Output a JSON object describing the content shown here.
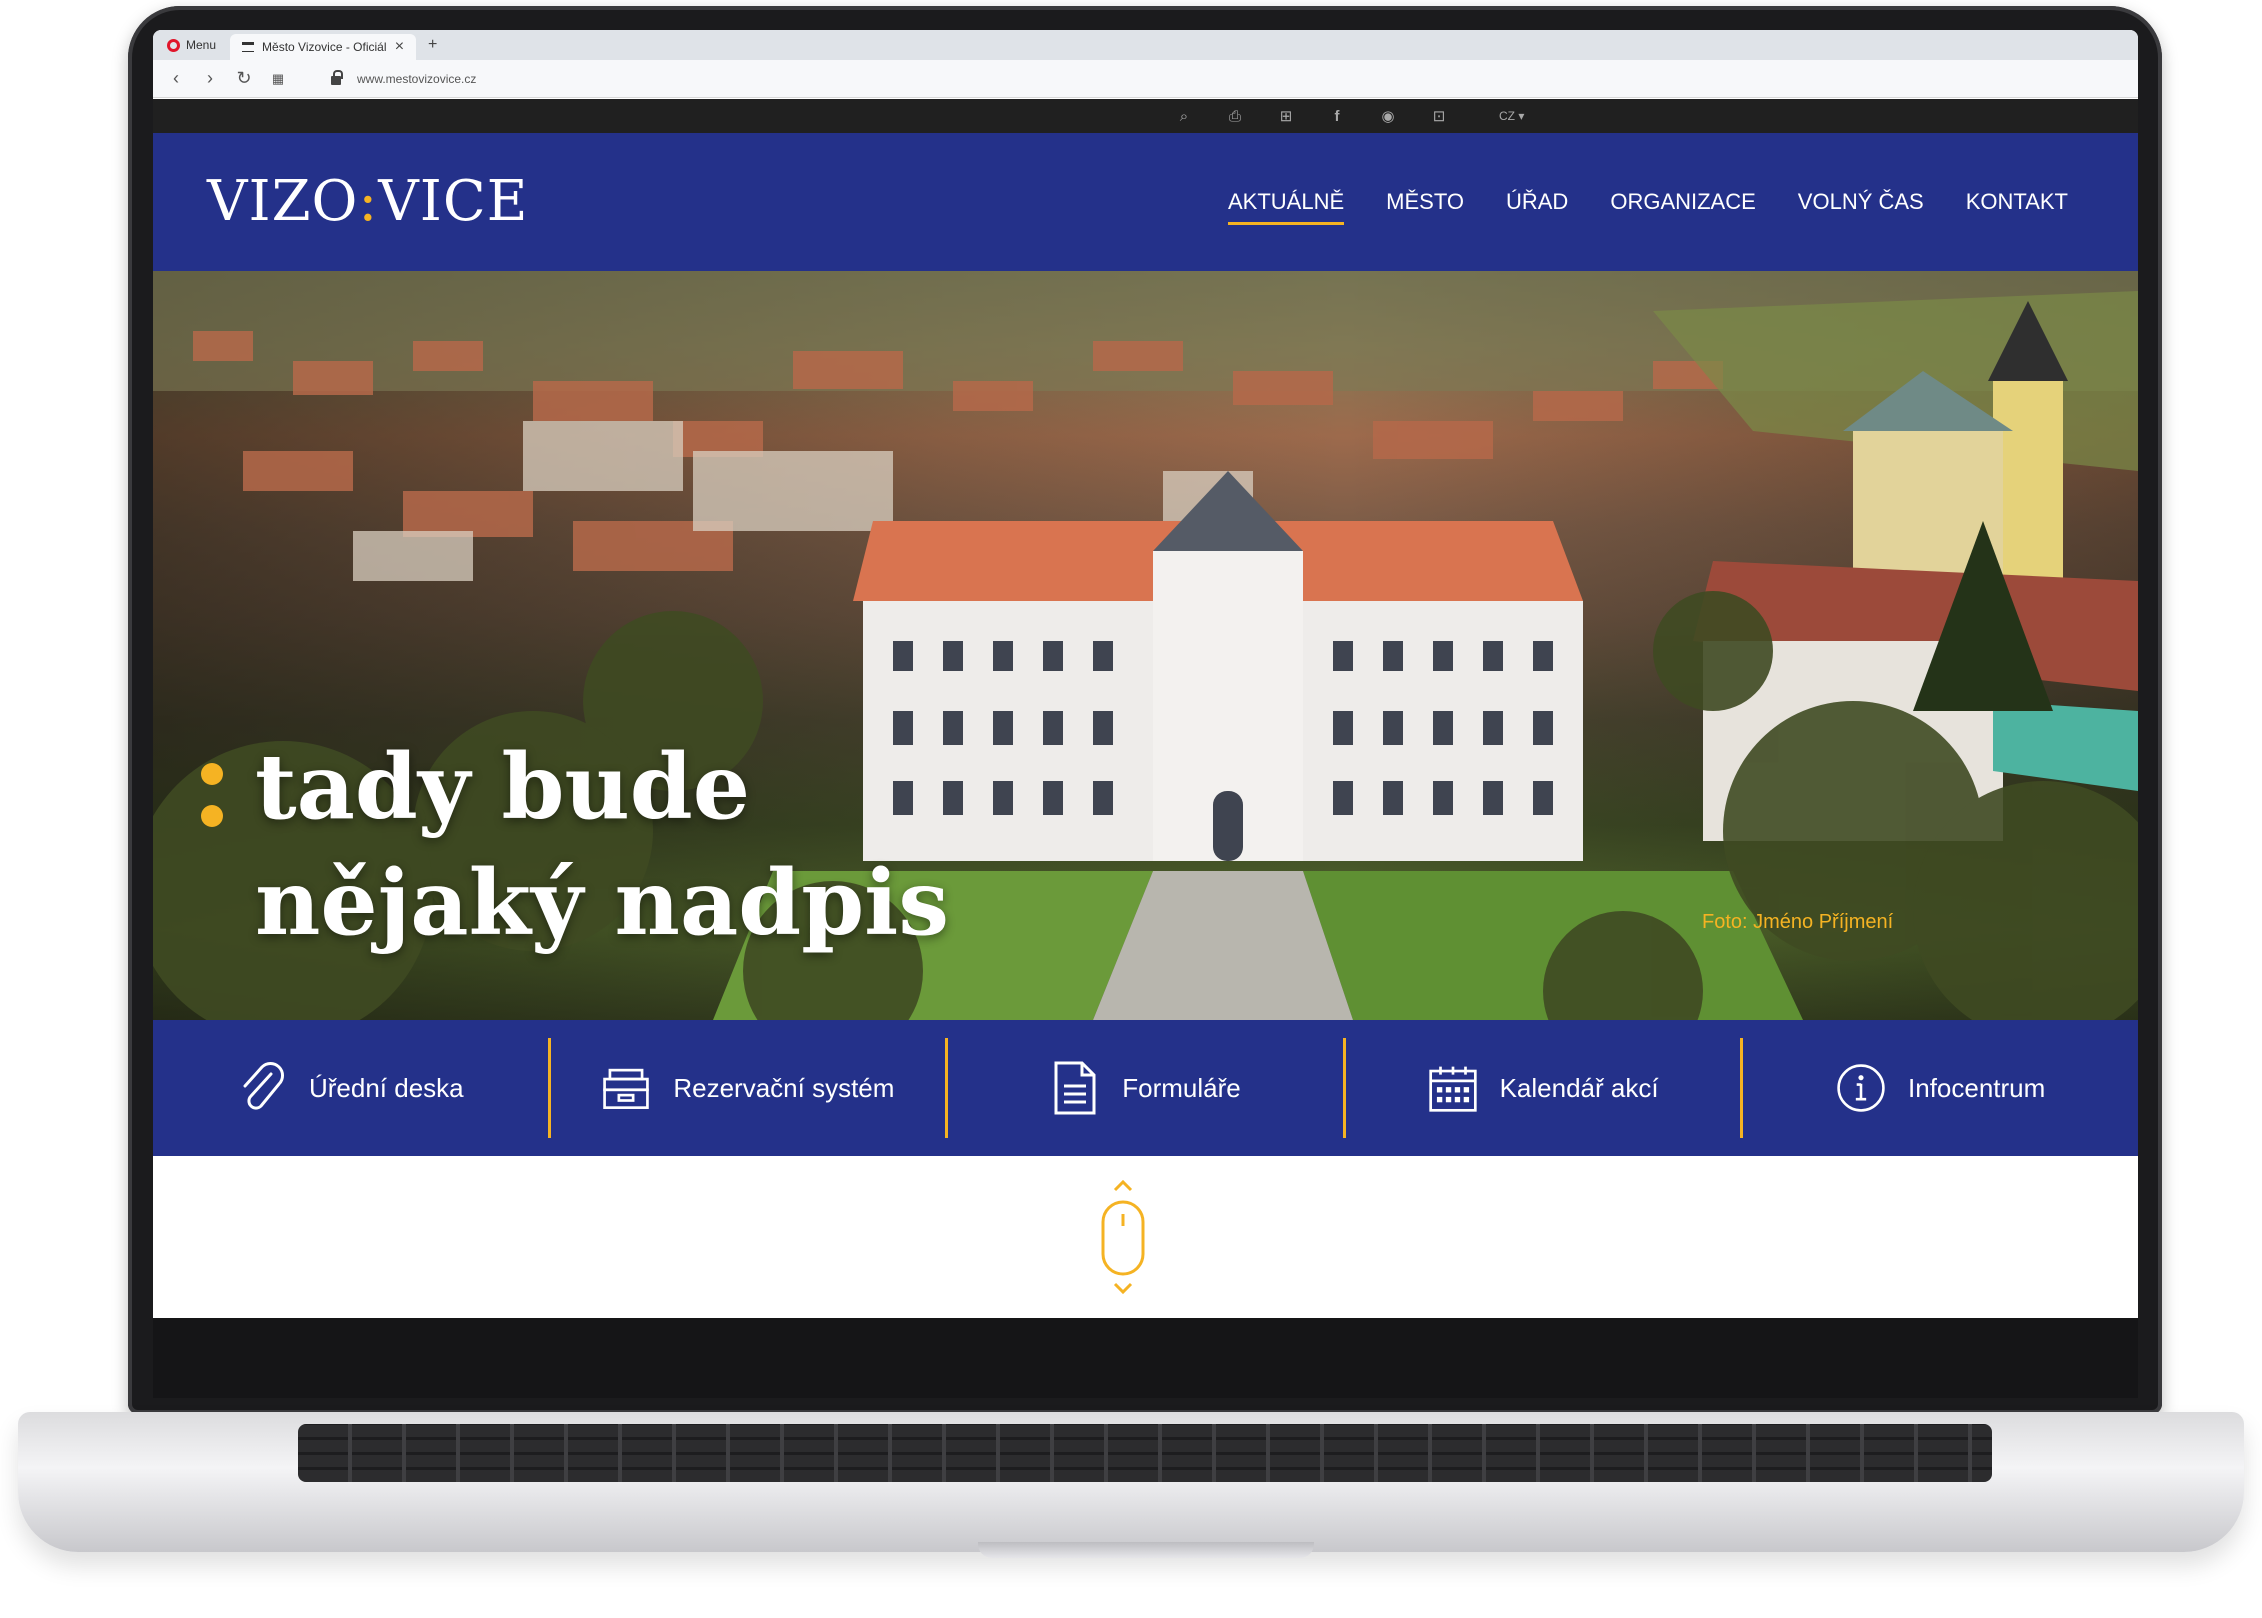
{
  "browser": {
    "menu_label": "Menu",
    "tab_title": "Město Vizovice - Oficiální s",
    "url": "www.mestovizovice.cz"
  },
  "toolbar": {
    "icons": [
      "search-icon",
      "print-icon",
      "sitemap-icon",
      "facebook-icon",
      "webcam-icon",
      "lock-icon"
    ],
    "language": "CZ"
  },
  "header": {
    "logo_left": "VIZO",
    "logo_colon": ":",
    "logo_right": "VICE",
    "nav": [
      "AKTUÁLNĚ",
      "MĚSTO",
      "ÚŘAD",
      "ORGANIZACE",
      "VOLNÝ ČAS",
      "KONTAKT"
    ],
    "active_nav": "AKTUÁLNĚ"
  },
  "hero": {
    "title_line1": "tady bude",
    "title_line2": "nějaký nadpis",
    "photo_credit": "Foto: Jméno Příjmení"
  },
  "quick_links": [
    {
      "label": "Úřední deska",
      "icon": "paperclip-icon"
    },
    {
      "label": "Rezervační systém",
      "icon": "archive-box-icon"
    },
    {
      "label": "Formuláře",
      "icon": "document-icon"
    },
    {
      "label": "Kalendář akcí",
      "icon": "calendar-icon"
    },
    {
      "label": "Infocentrum",
      "icon": "info-icon"
    }
  ],
  "colors": {
    "brand_blue": "#24318a",
    "accent_yellow": "#f5b323",
    "toolbar_dark": "#202020"
  }
}
